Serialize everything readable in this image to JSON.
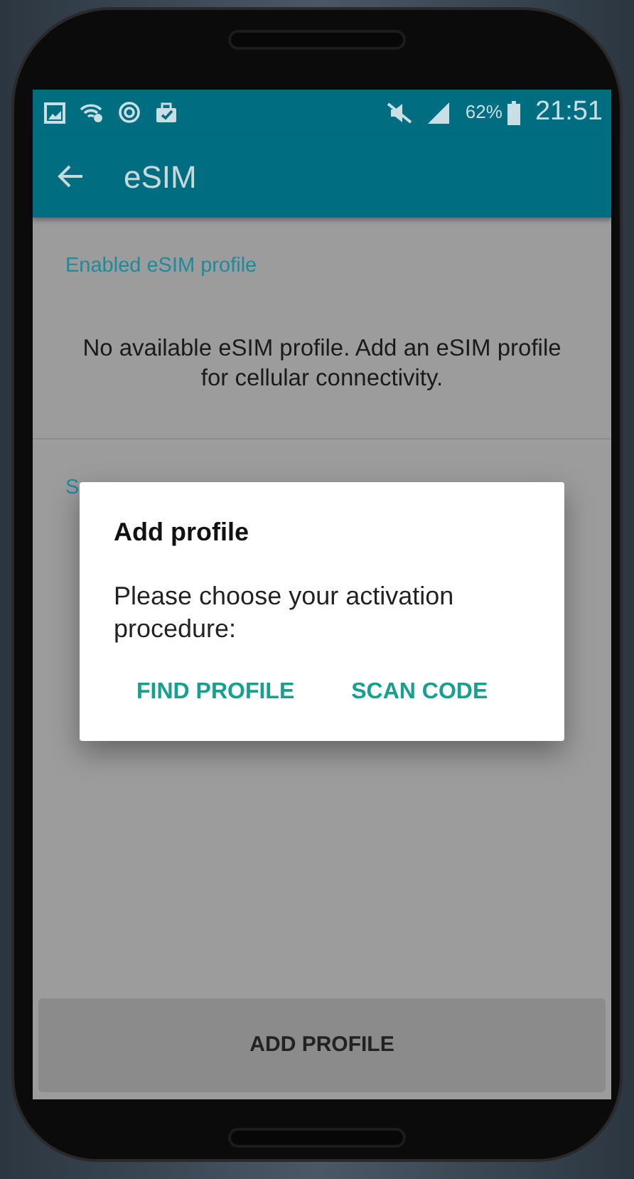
{
  "status_bar": {
    "battery": "62%",
    "time": "21:51"
  },
  "app_bar": {
    "title": "eSIM"
  },
  "sections": [
    {
      "header": "Enabled eSIM profile",
      "message": "No available eSIM profile. Add an eSIM profile for cellular connectivity."
    },
    {
      "header": "S"
    }
  ],
  "dialog": {
    "title": "Add profile",
    "message": "Please choose your activation procedure:",
    "actions": [
      "FIND PROFILE",
      "SCAN CODE"
    ]
  },
  "bottom_button": "ADD PROFILE"
}
